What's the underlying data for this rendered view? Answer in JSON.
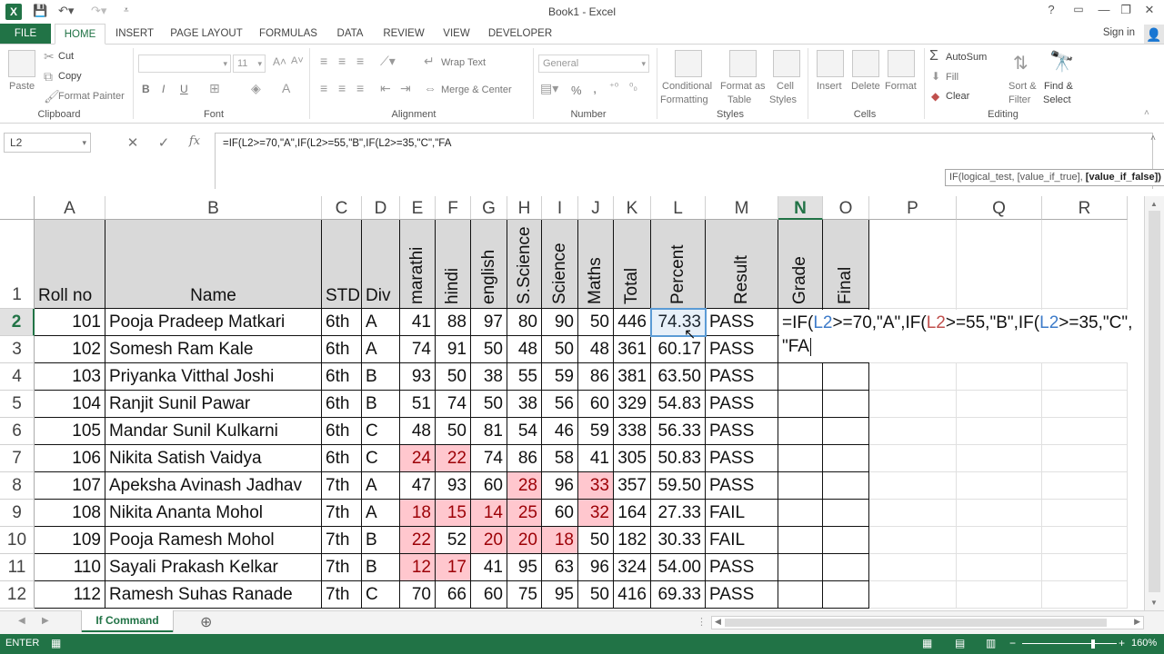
{
  "window": {
    "title": "Book1 - Excel",
    "logo": "X",
    "controls": [
      "?",
      "▭",
      "—",
      "❐",
      "✕"
    ]
  },
  "ribbon_tabs": [
    "FILE",
    "HOME",
    "INSERT",
    "PAGE LAYOUT",
    "FORMULAS",
    "DATA",
    "REVIEW",
    "VIEW",
    "DEVELOPER"
  ],
  "sign_in": "Sign in",
  "ribbon": {
    "clipboard": {
      "paste": "Paste",
      "cut": "Cut",
      "copy": "Copy",
      "format_painter": "Format Painter",
      "label": "Clipboard"
    },
    "font": {
      "size": "11",
      "bold": "B",
      "italic": "I",
      "underline": "U",
      "label": "Font"
    },
    "alignment": {
      "wrap_text": "Wrap Text",
      "merge_center": "Merge & Center",
      "label": "Alignment"
    },
    "number": {
      "format": "General",
      "percent": "%",
      "comma": ",",
      "label": "Number"
    },
    "styles": {
      "conditional": "Conditional",
      "formatting": "Formatting",
      "format_as": "Format as",
      "table": "Table",
      "cell": "Cell",
      "styles": "Styles",
      "label": "Styles"
    },
    "cells": {
      "insert": "Insert",
      "delete": "Delete",
      "format": "Format",
      "label": "Cells"
    },
    "editing": {
      "autosum": "AutoSum",
      "fill": "Fill",
      "clear": "Clear",
      "sort": "Sort &",
      "filter": "Filter",
      "find": "Find &",
      "select": "Select",
      "label": "Editing"
    }
  },
  "formula_bar": {
    "name_box": "L2",
    "cancel": "✕",
    "enter": "✓",
    "fx": "fx",
    "formula": "=IF(L2>=70,\"A\",IF(L2>=55,\"B\",IF(L2>=35,\"C\",\"FA"
  },
  "columns": [
    "A",
    "B",
    "C",
    "D",
    "E",
    "F",
    "G",
    "H",
    "I",
    "J",
    "K",
    "L",
    "M",
    "N",
    "O",
    "P",
    "Q",
    "R"
  ],
  "header_row": {
    "roll_no": "Roll no",
    "name": "Name",
    "std": "STD",
    "div": "Div",
    "marathi": "marathi",
    "hindi": "hindi",
    "english": "english",
    "sscience": "S.Science",
    "science": "Science",
    "maths": "Maths",
    "total": "Total",
    "percent": "Percent",
    "result": "Result",
    "grade": "Grade",
    "final": "Final"
  },
  "rows": [
    {
      "row": "2",
      "roll": "101",
      "name": "Pooja Pradeep Matkari",
      "std": "6th",
      "div": "A",
      "m": [
        "41",
        "88",
        "97",
        "80",
        "90",
        "50"
      ],
      "total": "446",
      "pct": "74.33",
      "result": "PASS"
    },
    {
      "row": "3",
      "roll": "102",
      "name": "Somesh Ram Kale",
      "std": "6th",
      "div": "A",
      "m": [
        "74",
        "91",
        "50",
        "48",
        "50",
        "48"
      ],
      "total": "361",
      "pct": "60.17",
      "result": "PASS"
    },
    {
      "row": "4",
      "roll": "103",
      "name": "Priyanka Vitthal Joshi",
      "std": "6th",
      "div": "B",
      "m": [
        "93",
        "50",
        "38",
        "55",
        "59",
        "86"
      ],
      "total": "381",
      "pct": "63.50",
      "result": "PASS"
    },
    {
      "row": "5",
      "roll": "104",
      "name": "Ranjit Sunil Pawar",
      "std": "6th",
      "div": "B",
      "m": [
        "51",
        "74",
        "50",
        "38",
        "56",
        "60"
      ],
      "total": "329",
      "pct": "54.83",
      "result": "PASS"
    },
    {
      "row": "6",
      "roll": "105",
      "name": "Mandar Sunil Kulkarni",
      "std": "6th",
      "div": "C",
      "m": [
        "48",
        "50",
        "81",
        "54",
        "46",
        "59"
      ],
      "total": "338",
      "pct": "56.33",
      "result": "PASS"
    },
    {
      "row": "7",
      "roll": "106",
      "name": "Nikita Satish Vaidya",
      "std": "6th",
      "div": "C",
      "m": [
        "24",
        "22",
        "74",
        "86",
        "58",
        "41"
      ],
      "total": "305",
      "pct": "50.83",
      "result": "PASS"
    },
    {
      "row": "8",
      "roll": "107",
      "name": "Apeksha Avinash Jadhav",
      "std": "7th",
      "div": "A",
      "m": [
        "47",
        "93",
        "60",
        "28",
        "96",
        "33"
      ],
      "total": "357",
      "pct": "59.50",
      "result": "PASS"
    },
    {
      "row": "9",
      "roll": "108",
      "name": "Nikita Ananta Mohol",
      "std": "7th",
      "div": "A",
      "m": [
        "18",
        "15",
        "14",
        "25",
        "60",
        "32"
      ],
      "total": "164",
      "pct": "27.33",
      "result": "FAIL"
    },
    {
      "row": "10",
      "roll": "109",
      "name": "Pooja Ramesh Mohol",
      "std": "7th",
      "div": "B",
      "m": [
        "22",
        "52",
        "20",
        "20",
        "18",
        "50"
      ],
      "total": "182",
      "pct": "30.33",
      "result": "FAIL"
    },
    {
      "row": "11",
      "roll": "110",
      "name": "Sayali Prakash Kelkar",
      "std": "7th",
      "div": "B",
      "m": [
        "12",
        "17",
        "41",
        "95",
        "63",
        "96"
      ],
      "total": "324",
      "pct": "54.00",
      "result": "PASS"
    },
    {
      "row": "12",
      "roll": "112",
      "name": "Ramesh Suhas Ranade",
      "std": "7th",
      "div": "C",
      "m": [
        "70",
        "66",
        "60",
        "75",
        "95",
        "50"
      ],
      "total": "416",
      "pct": "69.33",
      "result": "PASS"
    }
  ],
  "editing_text": {
    "line1_parts": [
      "=IF(",
      "L2",
      ">=70,\"A\",IF(",
      "L2",
      ">=55,\"B\",IF(",
      "L2",
      ">=35,\"C\","
    ],
    "line2": "\"FA"
  },
  "tooltip": {
    "text": "IF(logical_test, [value_if_true], ",
    "bold": "[value_if_false])"
  },
  "sheet_tab": "If Command",
  "add_sheet": "⊕",
  "status": {
    "mode": "ENTER",
    "zoom": "160%"
  },
  "colors": {
    "accent": "#217346",
    "bad_fill": "#ffc7ce",
    "bad_text": "#9c0006",
    "ref_blue": "#3d7bc9",
    "ref_red": "#c0504d"
  }
}
